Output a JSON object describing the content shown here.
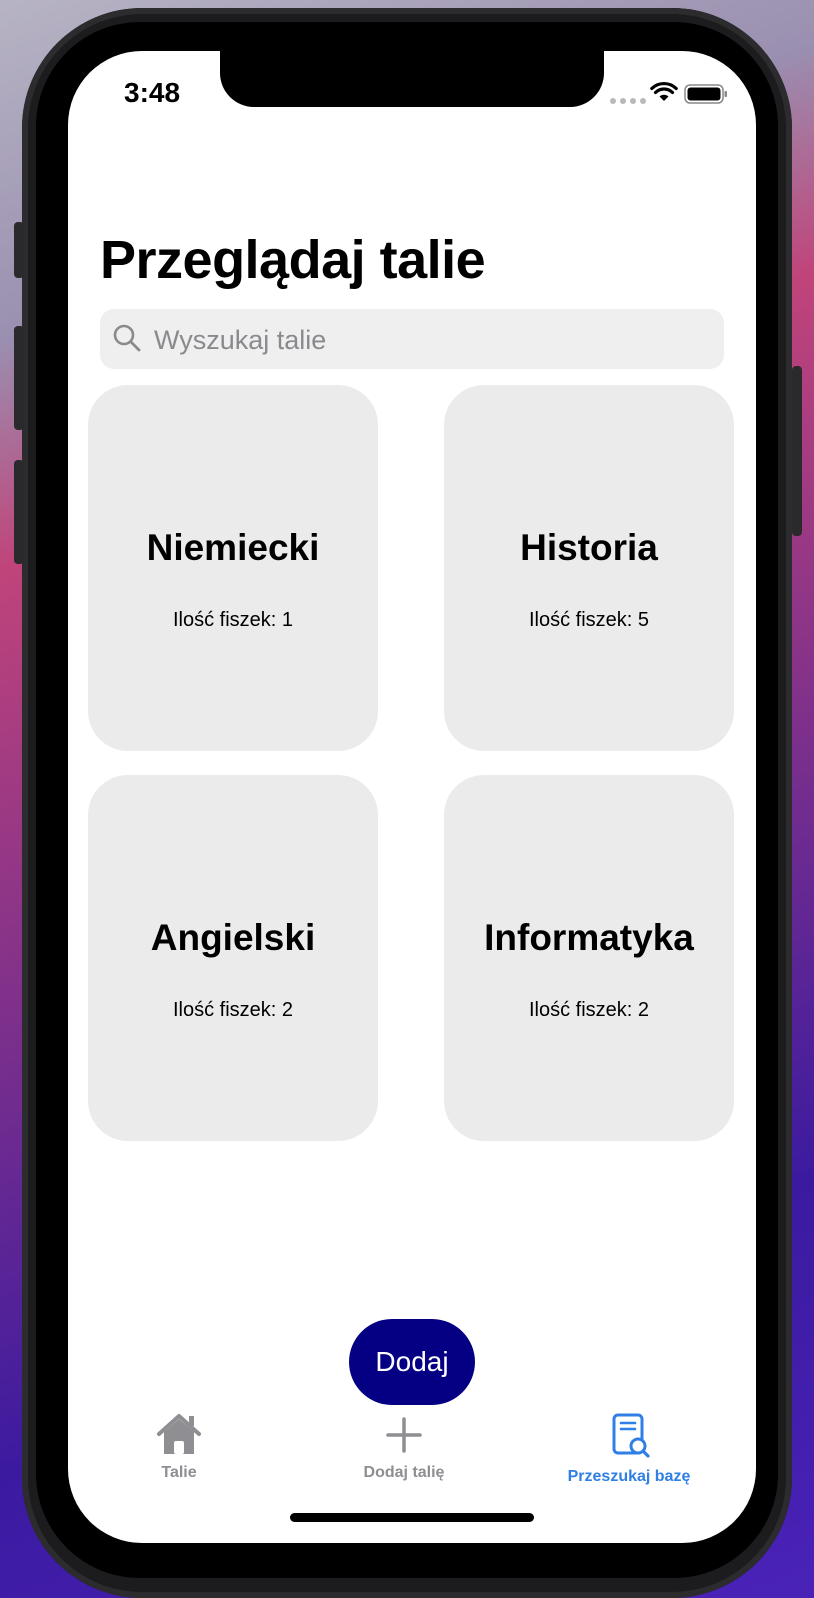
{
  "status_bar": {
    "time": "3:48"
  },
  "header": {
    "title": "Przeglądaj talie"
  },
  "search": {
    "placeholder": "Wyszukaj talie",
    "value": ""
  },
  "decks": [
    {
      "name": "Niemiecki",
      "count_text": "Ilość fiszek: 1"
    },
    {
      "name": "Historia",
      "count_text": "Ilość fiszek: 5"
    },
    {
      "name": "Angielski",
      "count_text": "Ilość fiszek: 2"
    },
    {
      "name": "Informatyka",
      "count_text": "Ilość fiszek: 2"
    }
  ],
  "add_button": {
    "label": "Dodaj"
  },
  "tab_bar": {
    "items": [
      {
        "label": "Talie",
        "icon": "house-icon",
        "active": false
      },
      {
        "label": "Dodaj talię",
        "icon": "plus-icon",
        "active": false
      },
      {
        "label": "Przeszukaj bazę",
        "icon": "doc-search-icon",
        "active": true
      }
    ]
  },
  "colors": {
    "accent": "#2f7fe6",
    "button_bg": "#050083",
    "card_bg": "#ebebeb",
    "inactive_tab": "#8e8e93"
  }
}
